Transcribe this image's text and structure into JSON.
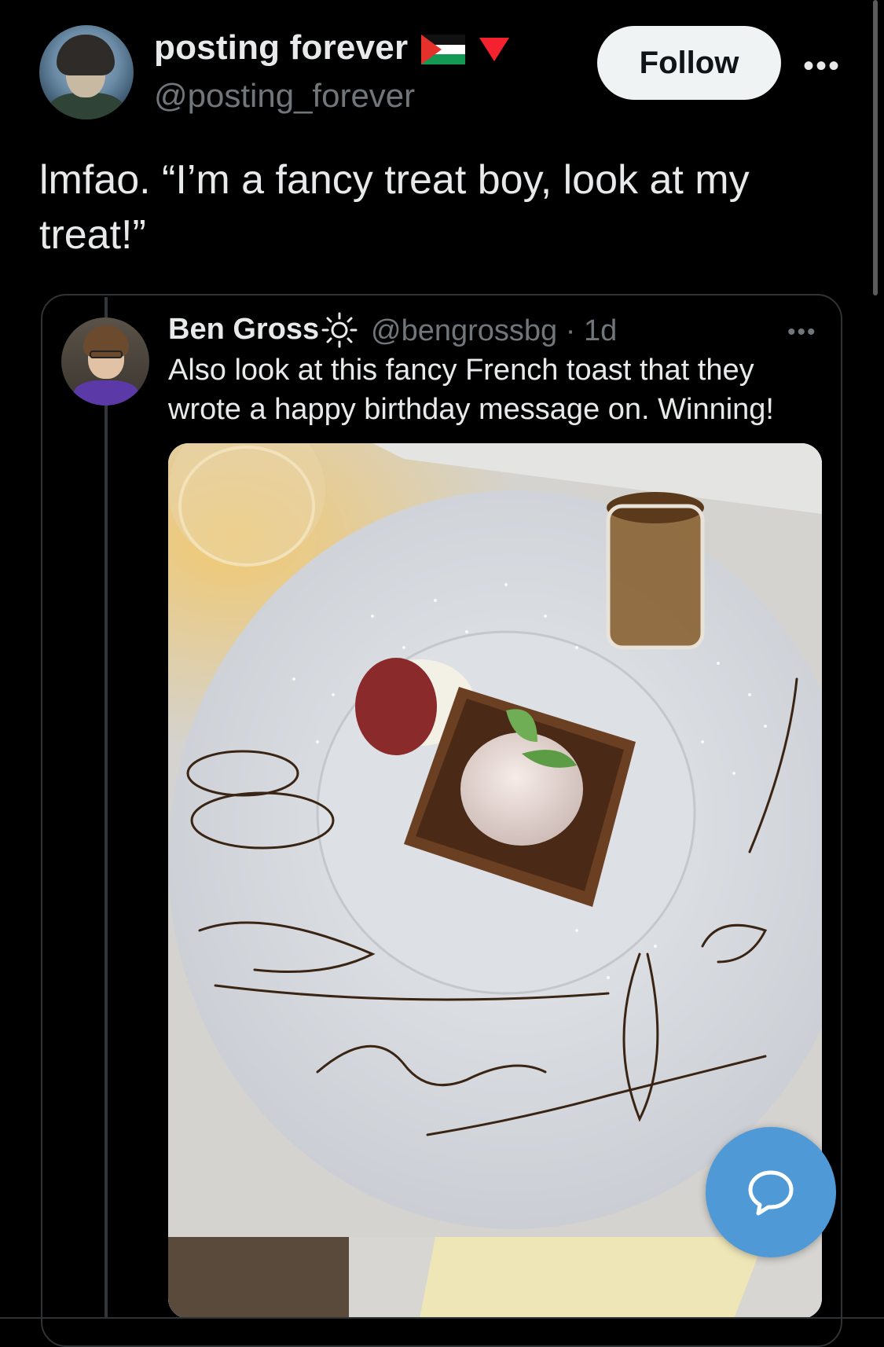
{
  "tweet": {
    "author": {
      "display_name": "posting forever",
      "handle": "@posting_forever",
      "avatar_icon": "portrait-avatar",
      "badges": [
        "palestine-flag-icon",
        "red-triangle-icon"
      ]
    },
    "follow_label": "Follow",
    "more_icon": "more-options-icon",
    "text": "lmfao. “I’m a fancy treat boy, look at my treat!”"
  },
  "quoted_tweet": {
    "author": {
      "display_name": "Ben Gross",
      "badge": "sun-emoji-icon",
      "handle": "@bengrossbg",
      "timestamp": "· 1d"
    },
    "more_icon": "more-options-icon",
    "text": "Also look at this fancy French toast that they wrote a happy birthday message on. Winning!",
    "media": {
      "type": "photo",
      "plate_writing": [
        "Happy",
        "Birthday",
        "Ben"
      ]
    }
  },
  "fab": {
    "icon": "compose-reply-icon"
  },
  "colors": {
    "background": "#000000",
    "text_primary": "#e7e9ea",
    "text_secondary": "#71767b",
    "follow_bg": "#eff3f4",
    "fab_bg": "#4f9ad6",
    "border": "#2f3336"
  }
}
